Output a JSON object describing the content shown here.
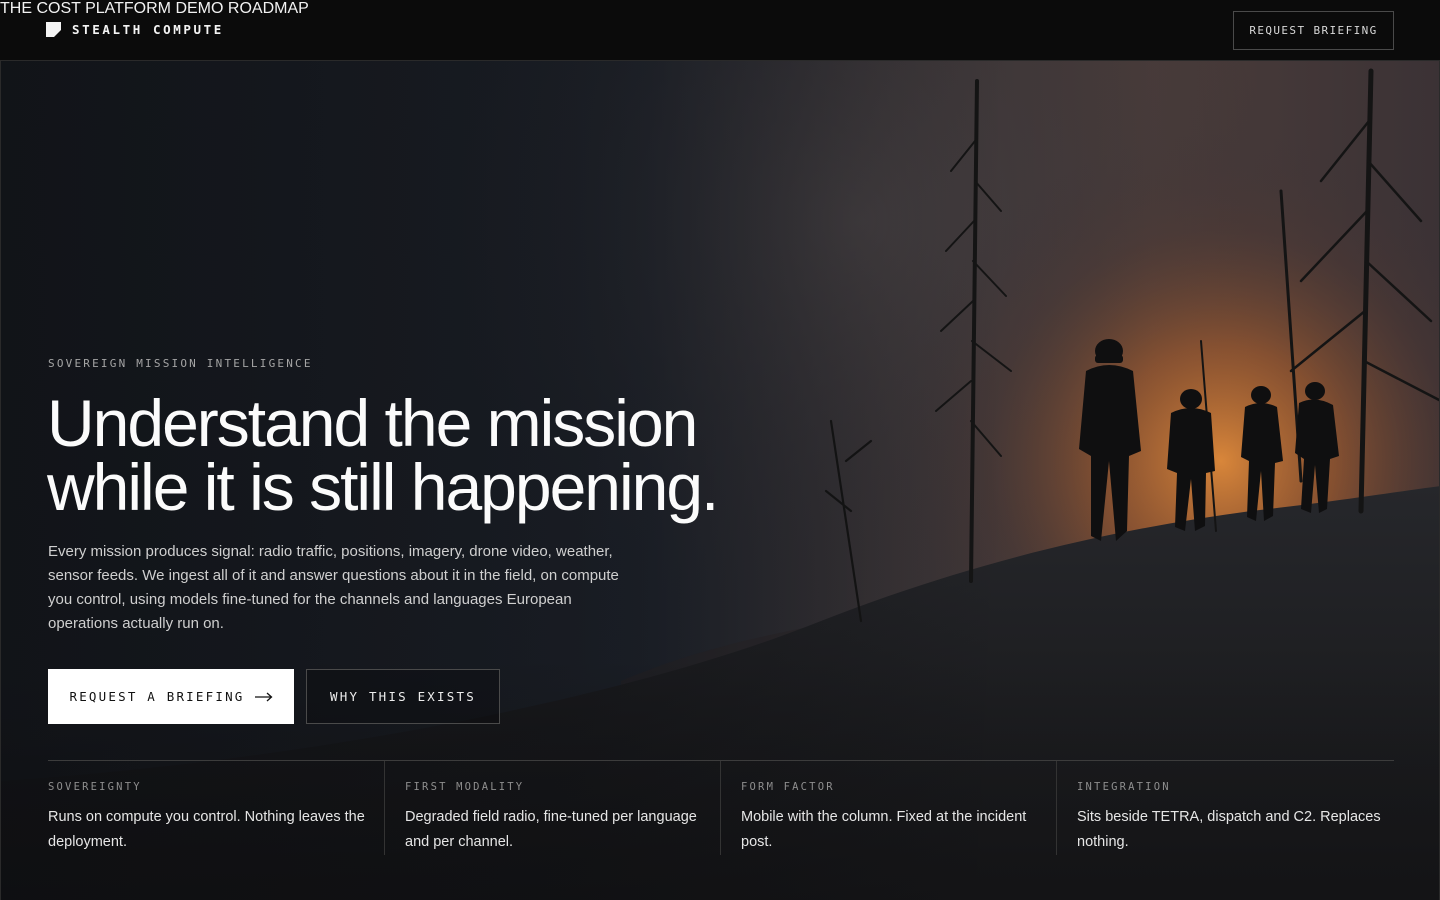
{
  "header": {
    "brand": "STEALTH COMPUTE",
    "brand_icon": "logo-mark-icon",
    "nav": [
      {
        "label": "THE COST"
      },
      {
        "label": "PLATFORM"
      },
      {
        "label": "DEMO"
      },
      {
        "label": "ROADMAP"
      }
    ],
    "cta": "REQUEST BRIEFING"
  },
  "hero": {
    "eyebrow": "SOVEREIGN MISSION INTELLIGENCE",
    "headline_line1": "Understand the mission",
    "headline_line2": "while it is still happening.",
    "lede": "Every mission produces signal: radio traffic, positions, imagery, drone video, weather, sensor feeds. We ingest all of it and answer questions about it in the field, on compute you control, using models fine-tuned for the channels and languages European operations actually run on.",
    "primary_button": "REQUEST A BRIEFING",
    "primary_icon": "arrow-right-icon",
    "secondary_button": "WHY THIS EXISTS",
    "background_image": "firefighters-silhouette-wildfire-photo"
  },
  "features": [
    {
      "label": "SOVEREIGNTY",
      "text": "Runs on compute you control. Nothing leaves the deployment."
    },
    {
      "label": "FIRST MODALITY",
      "text": "Degraded field radio, fine-tuned per language and per channel."
    },
    {
      "label": "FORM FACTOR",
      "text": "Mobile with the column. Fixed at the incident post."
    },
    {
      "label": "INTEGRATION",
      "text": "Sits beside TETRA, dispatch and C2. Replaces nothing."
    }
  ],
  "colors": {
    "header_bg": "#0b0b0b",
    "sky_dark": "#1b2029",
    "fire_glow": "#d0762a",
    "text_primary": "#fbfbfb",
    "text_muted": "#a5a5a5",
    "button_primary_bg": "#ffffff"
  }
}
